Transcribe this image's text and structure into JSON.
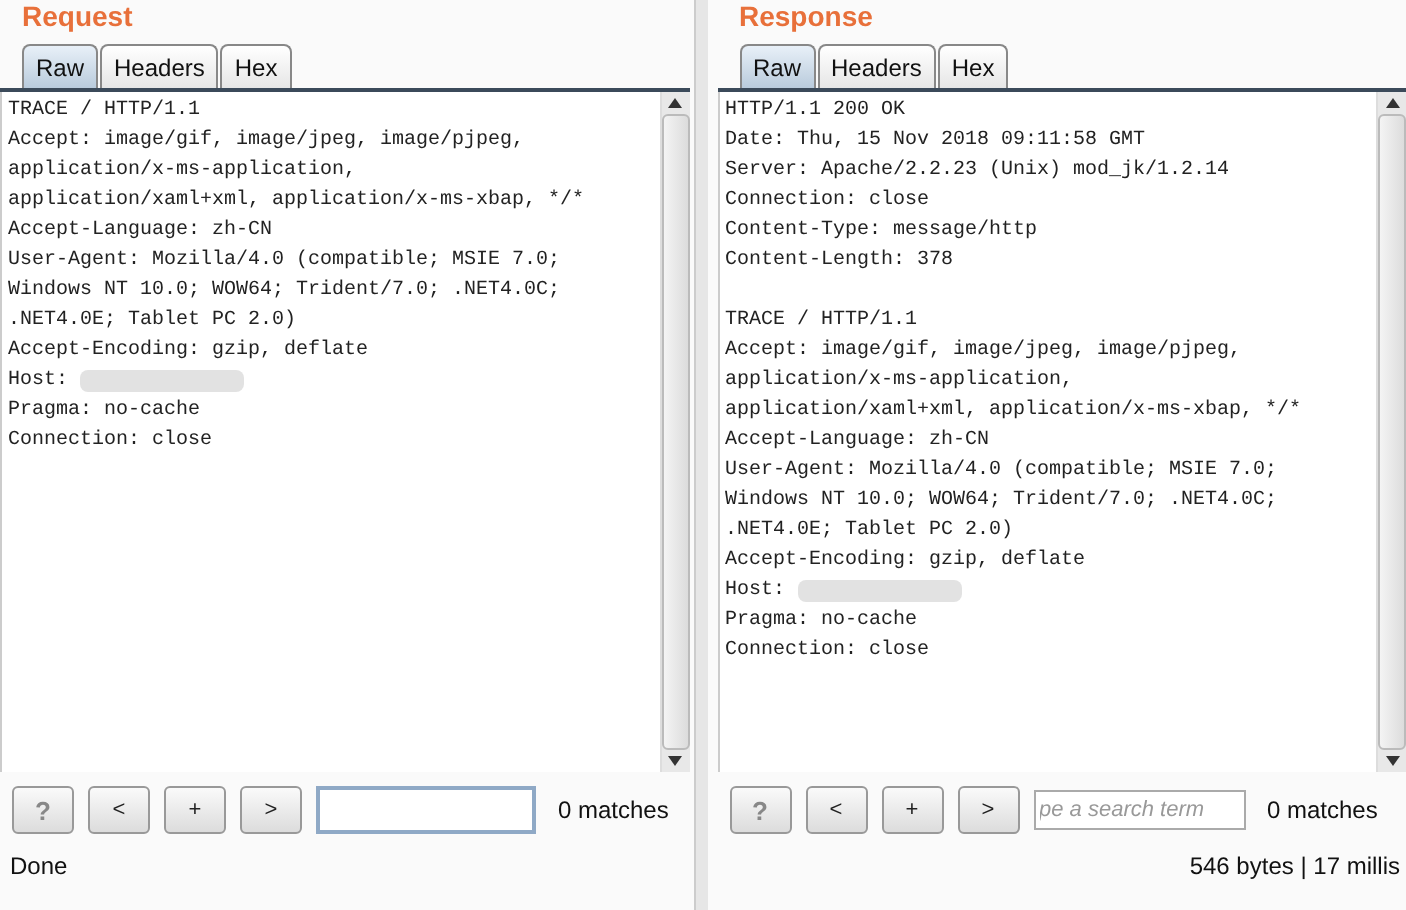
{
  "panels": [
    {
      "title": "Request",
      "tabs": [
        {
          "label": "Raw",
          "selected": true
        },
        {
          "label": "Headers",
          "selected": false
        },
        {
          "label": "Hex",
          "selected": false
        }
      ],
      "lines": [
        {
          "kind": "text",
          "text": "TRACE / HTTP/1.1"
        },
        {
          "kind": "text",
          "text": "Accept: image/gif, image/jpeg, image/pjpeg,"
        },
        {
          "kind": "text",
          "text": "application/x-ms-application,"
        },
        {
          "kind": "text",
          "text": "application/xaml+xml, application/x-ms-xbap, */*"
        },
        {
          "kind": "text",
          "text": "Accept-Language: zh-CN"
        },
        {
          "kind": "text",
          "text": "User-Agent: Mozilla/4.0 (compatible; MSIE 7.0;"
        },
        {
          "kind": "text",
          "text": "Windows NT 10.0; WOW64; Trident/7.0; .NET4.0C;"
        },
        {
          "kind": "text",
          "text": ".NET4.0E; Tablet PC 2.0)"
        },
        {
          "kind": "text",
          "text": "Accept-Encoding: gzip, deflate"
        },
        {
          "kind": "redacted",
          "text": "Host:"
        },
        {
          "kind": "text",
          "text": "Pragma: no-cache"
        },
        {
          "kind": "text",
          "text": "Connection: close"
        }
      ],
      "buttons": [
        "?",
        "<",
        "+",
        ">"
      ],
      "search": {
        "focused": true
      },
      "matches": "0 matches",
      "status": "Done"
    },
    {
      "title": "Response",
      "tabs": [
        {
          "label": "Raw",
          "selected": true
        },
        {
          "label": "Headers",
          "selected": false
        },
        {
          "label": "Hex",
          "selected": false
        }
      ],
      "lines": [
        {
          "kind": "text",
          "text": "HTTP/1.1 200 OK"
        },
        {
          "kind": "text",
          "text": "Date: Thu, 15 Nov 2018 09:11:58 GMT"
        },
        {
          "kind": "text",
          "text": "Server: Apache/2.2.23 (Unix) mod_jk/1.2.14"
        },
        {
          "kind": "text",
          "text": "Connection: close"
        },
        {
          "kind": "text",
          "text": "Content-Type: message/http"
        },
        {
          "kind": "text",
          "text": "Content-Length: 378"
        },
        {
          "kind": "blank"
        },
        {
          "kind": "text",
          "text": "TRACE / HTTP/1.1"
        },
        {
          "kind": "text",
          "text": "Accept: image/gif, image/jpeg, image/pjpeg,"
        },
        {
          "kind": "text",
          "text": "application/x-ms-application,"
        },
        {
          "kind": "text",
          "text": "application/xaml+xml, application/x-ms-xbap, */*"
        },
        {
          "kind": "text",
          "text": "Accept-Language: zh-CN"
        },
        {
          "kind": "text",
          "text": "User-Agent: Mozilla/4.0 (compatible; MSIE 7.0;"
        },
        {
          "kind": "text",
          "text": "Windows NT 10.0; WOW64; Trident/7.0; .NET4.0C;"
        },
        {
          "kind": "text",
          "text": ".NET4.0E; Tablet PC 2.0)"
        },
        {
          "kind": "text",
          "text": "Accept-Encoding: gzip, deflate"
        },
        {
          "kind": "redacted",
          "text": "Host:"
        },
        {
          "kind": "text",
          "text": "Pragma: no-cache"
        },
        {
          "kind": "text",
          "text": "Connection: close"
        }
      ],
      "buttons": [
        "?",
        "<",
        "+",
        ">"
      ],
      "search": {
        "placeholder": "pe a search term",
        "focused": false
      },
      "matches": "0 matches",
      "status": "546 bytes | 17 millis"
    }
  ]
}
